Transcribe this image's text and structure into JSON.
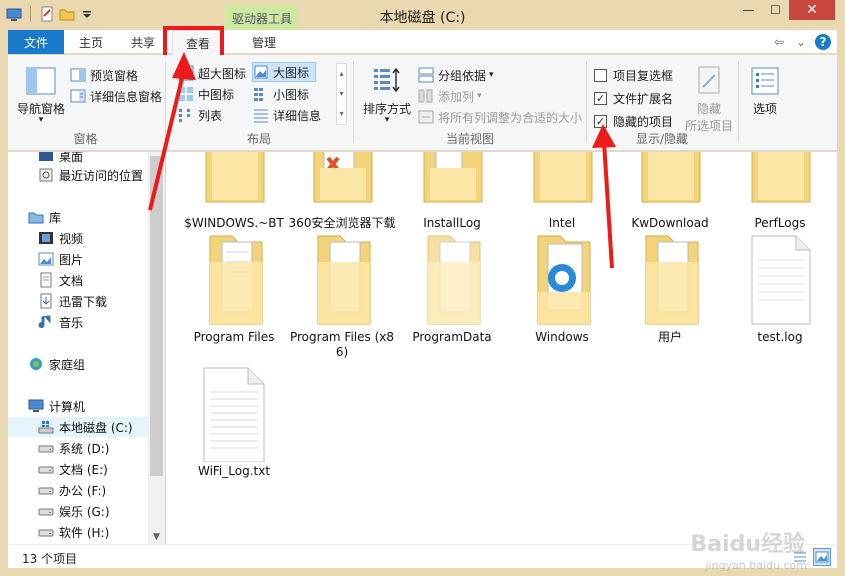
{
  "window": {
    "title": "本地磁盘 (C:)",
    "contextual_tab": "驱动器工具"
  },
  "tabs": [
    {
      "label": "文件"
    },
    {
      "label": "主页"
    },
    {
      "label": "共享"
    },
    {
      "label": "查看"
    },
    {
      "label": "管理"
    }
  ],
  "ribbon": {
    "panes": {
      "label": "窗格",
      "nav_pane": "导航窗格",
      "preview_pane": "预览窗格",
      "details_pane": "详细信息窗格"
    },
    "layout": {
      "label": "布局",
      "extra_large": "超大图标",
      "large": "大图标",
      "medium": "中图标",
      "small": "小图标",
      "list": "列表",
      "details": "详细信息"
    },
    "current_view": {
      "label": "当前视图",
      "sort_by": "排序方式",
      "group_by": "分组依据",
      "add_columns": "添加列",
      "size_all_columns": "将所有列调整为合适的大小"
    },
    "show_hide": {
      "label": "显示/隐藏",
      "item_checkboxes": "项目复选框",
      "item_checkboxes_checked": false,
      "file_extensions": "文件扩展名",
      "file_extensions_checked": true,
      "hidden_items": "隐藏的项目",
      "hidden_items_checked": true,
      "hide_selected_line1": "隐藏",
      "hide_selected_line2": "所选项目"
    },
    "options": "选项"
  },
  "nav": {
    "items": [
      {
        "label": "桌面"
      },
      {
        "label": "最近访问的位置"
      },
      {
        "label": "库"
      },
      {
        "label": "视频"
      },
      {
        "label": "图片"
      },
      {
        "label": "文档"
      },
      {
        "label": "迅雷下载"
      },
      {
        "label": "音乐"
      },
      {
        "label": "家庭组"
      },
      {
        "label": "计算机"
      },
      {
        "label": "本地磁盘 (C:)"
      },
      {
        "label": "系统 (D:)"
      },
      {
        "label": "文档 (E:)"
      },
      {
        "label": "办公 (F:)"
      },
      {
        "label": "娱乐 (G:)"
      },
      {
        "label": "软件 (H:)"
      }
    ]
  },
  "files": [
    {
      "name": "$WINDOWS.~BT",
      "type": "folder"
    },
    {
      "name": "360安全浏览器下载",
      "type": "folder"
    },
    {
      "name": "InstallLog",
      "type": "folder"
    },
    {
      "name": "Intel",
      "type": "folder"
    },
    {
      "name": "KwDownload",
      "type": "folder"
    },
    {
      "name": "PerfLogs",
      "type": "folder"
    },
    {
      "name": "Program Files",
      "type": "folder"
    },
    {
      "name": "Program Files (x86)",
      "type": "folder"
    },
    {
      "name": "ProgramData",
      "type": "folder"
    },
    {
      "name": "Windows",
      "type": "folder"
    },
    {
      "name": "用户",
      "type": "folder"
    },
    {
      "name": "test.log",
      "type": "file"
    },
    {
      "name": "WiFi_Log.txt",
      "type": "file"
    }
  ],
  "status": {
    "count": "13 个项目"
  },
  "watermark": {
    "main": "Baidu经验",
    "sub": "jingyan.baidu.com"
  },
  "colors": {
    "accent": "#1979ca",
    "highlight": "#ee1a1a",
    "frame": "#ead8b0",
    "contextual": "#cde9a0"
  }
}
